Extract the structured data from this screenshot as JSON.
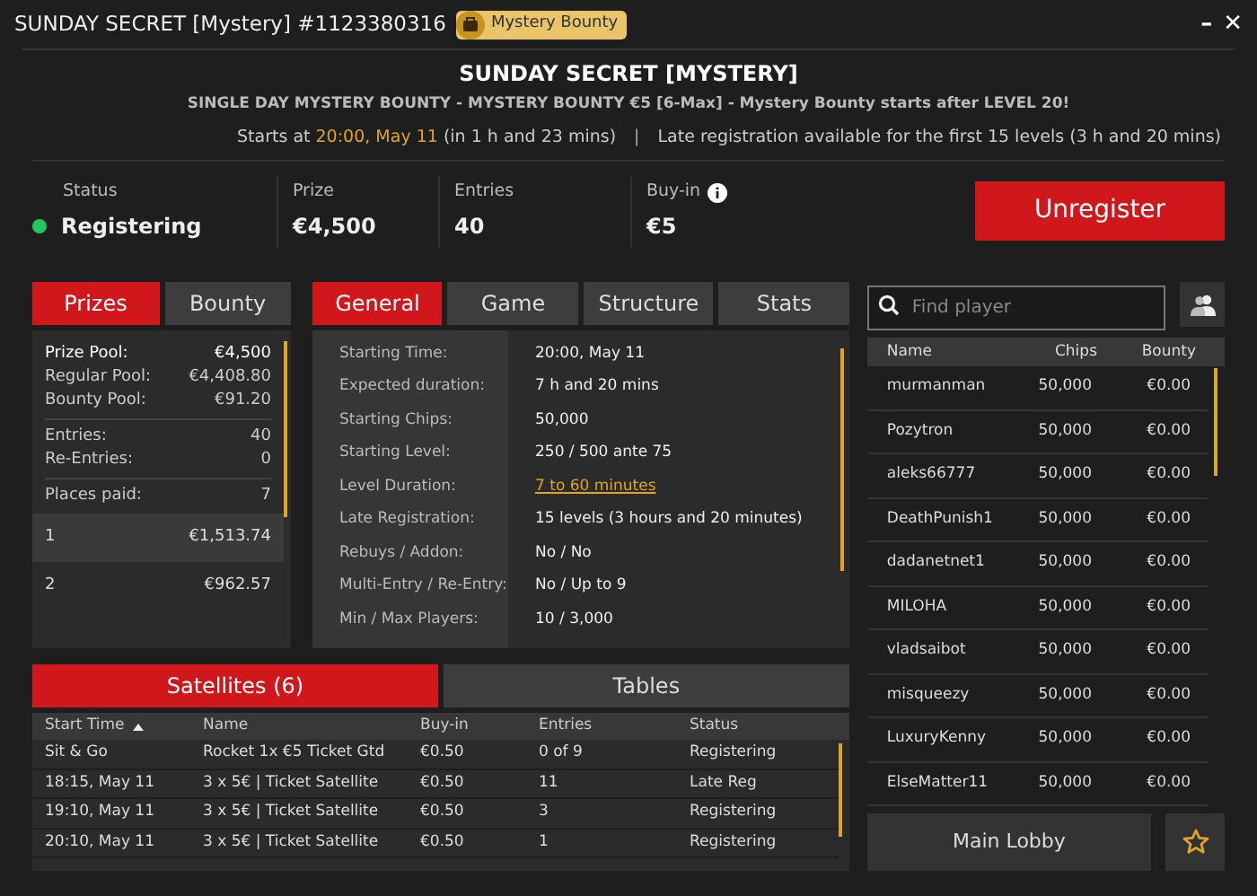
{
  "window": {
    "title": "SUNDAY SECRET [Mystery] #1123380316",
    "badge": "Mystery Bounty",
    "controls": [
      "–",
      "✕"
    ]
  },
  "header": {
    "title": "SUNDAY SECRET [MYSTERY]",
    "subtitle": "SINGLE DAY MYSTERY BOUNTY - MYSTERY BOUNTY €5 [6-Max] - Mystery Bounty starts after LEVEL 20!",
    "starts_label": "Starts at",
    "starts_time": "20:00, May 11",
    "starts_in": "(in 1 h and 23 mins)",
    "separator": "|",
    "late_reg": "Late registration available for the first 15 levels",
    "late_reg_time": "(3 h and 20 mins)"
  },
  "stats": [
    {
      "label": "Status",
      "value": "Registering",
      "color": "#22c55e"
    },
    {
      "label": "Prize",
      "value": "€4,500"
    },
    {
      "label": "Entries",
      "value": "40"
    },
    {
      "label": "Buy-in",
      "value": "€5",
      "info": true
    }
  ],
  "unregister_button": "Unregister",
  "prizes_panel": {
    "tabs": [
      {
        "label": "Prizes",
        "selected": true
      },
      {
        "label": "Bounty",
        "selected": false
      }
    ],
    "groups": [
      [
        {
          "label": "Prize Pool:",
          "value": "€4,500",
          "strong": true
        },
        {
          "label": "Regular Pool:",
          "value": "€4,408.80",
          "strong": false
        },
        {
          "label": "Bounty Pool:",
          "value": "€91.20",
          "strong": false
        }
      ],
      [
        {
          "label": "Entries:",
          "value": "40",
          "strong": false
        },
        {
          "label": "Re-Entries:",
          "value": "0",
          "strong": false
        }
      ],
      [
        {
          "label": "Places paid:",
          "value": "7",
          "strong": false
        }
      ]
    ],
    "payouts": [
      {
        "place": "1",
        "amount": "€1,513.74"
      },
      {
        "place": "2",
        "amount": "€962.57"
      }
    ]
  },
  "info_panel": {
    "tabs": [
      {
        "label": "General",
        "selected": true
      },
      {
        "label": "Game",
        "selected": false
      },
      {
        "label": "Structure",
        "selected": false
      },
      {
        "label": "Stats",
        "selected": false
      }
    ],
    "rows": [
      {
        "label": "Starting Time:",
        "value": "20:00, May 11",
        "link": false
      },
      {
        "label": "Expected duration:",
        "value": "7 h and 20 mins",
        "link": false
      },
      {
        "label": "Starting Chips:",
        "value": "50,000",
        "link": false
      },
      {
        "label": "Starting Level:",
        "value": "250 / 500 ante 75",
        "link": false
      },
      {
        "label": "Level Duration:",
        "value": "7 to 60 minutes",
        "link": true
      },
      {
        "label": "Late Registration:",
        "value": "15 levels (3 hours and 20 minutes)",
        "link": false
      },
      {
        "label": "Rebuys / Addon:",
        "value": "No / No",
        "link": false
      },
      {
        "label": "Multi-Entry / Re-Entry:",
        "value": "No / Up to 9",
        "link": false
      },
      {
        "label": "Min / Max Players:",
        "value": "10 / 3,000",
        "link": false
      }
    ]
  },
  "bottom_tabs": [
    {
      "label": "Satellites (6)",
      "selected": true
    },
    {
      "label": "Tables",
      "selected": false
    }
  ],
  "satellites": {
    "columns": [
      {
        "label": "Start Time",
        "sorted": true
      },
      {
        "label": "Name",
        "sorted": false
      },
      {
        "label": "Buy-in",
        "sorted": false
      },
      {
        "label": "Entries",
        "sorted": false
      },
      {
        "label": "Status",
        "sorted": false
      }
    ],
    "rows": [
      [
        "Sit & Go",
        "Rocket 1x €5 Ticket Gtd",
        "€0.50",
        "0 of 9",
        "Registering"
      ],
      [
        "18:15, May 11",
        "3 x 5€ | Ticket Satellite",
        "€0.50",
        "11",
        "Late Reg"
      ],
      [
        "19:10, May 11",
        "3 x 5€ | Ticket Satellite",
        "€0.50",
        "3",
        "Registering"
      ],
      [
        "20:10, May 11",
        "3 x 5€ | Ticket Satellite",
        "€0.50",
        "1",
        "Registering"
      ]
    ]
  },
  "players": {
    "search_placeholder": "Find player",
    "columns": [
      "Name",
      "Chips",
      "Bounty"
    ],
    "rows": [
      [
        "murmanman",
        "50,000",
        "€0.00"
      ],
      [
        "Pozytron",
        "50,000",
        "€0.00"
      ],
      [
        "aleks66777",
        "50,000",
        "€0.00"
      ],
      [
        "DeathPunish1",
        "50,000",
        "€0.00"
      ],
      [
        "dadanetnet1",
        "50,000",
        "€0.00"
      ],
      [
        "MILOHA",
        "50,000",
        "€0.00"
      ],
      [
        "vladsaibot",
        "50,000",
        "€0.00"
      ],
      [
        "misqueezy",
        "50,000",
        "€0.00"
      ],
      [
        "LuxuryKenny",
        "50,000",
        "€0.00"
      ],
      [
        "ElseMatter11",
        "50,000",
        "€0.00"
      ]
    ]
  },
  "main_lobby_button": "Main Lobby"
}
